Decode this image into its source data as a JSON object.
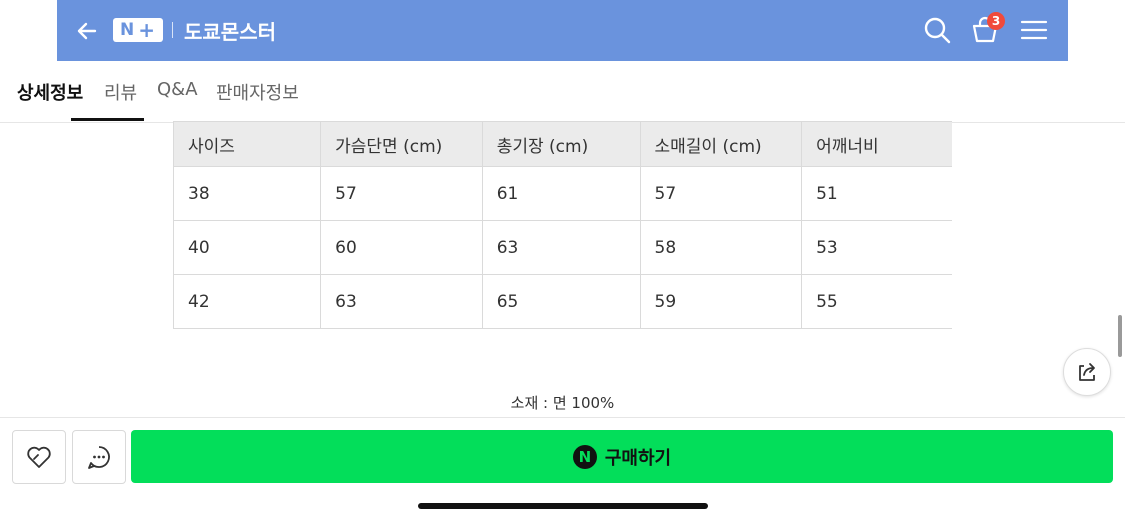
{
  "header": {
    "logo_text": "N",
    "logo_plus": "+",
    "store_title": "도쿄몬스터",
    "cart_count": "3",
    "icons": [
      "back-arrow-icon",
      "search-icon",
      "cart-icon",
      "menu-icon"
    ],
    "background_color": "#6a93dd"
  },
  "tabs": [
    {
      "label": "상세정보",
      "active": true
    },
    {
      "label": "리뷰",
      "active": false
    },
    {
      "label": "Q&A",
      "active": false
    },
    {
      "label": "판매자정보",
      "active": false
    }
  ],
  "size_table": {
    "headers": [
      "사이즈",
      "가슴단면 (cm)",
      "총기장 (cm)",
      "소매길이 (cm)",
      "어깨너비"
    ],
    "rows": [
      [
        "38",
        "57",
        "61",
        "57",
        "51"
      ],
      [
        "40",
        "60",
        "63",
        "58",
        "53"
      ],
      [
        "42",
        "63",
        "65",
        "59",
        "55"
      ]
    ]
  },
  "material_text": "소재 : 면 100%",
  "bottom_bar": {
    "buy_icon_text": "N",
    "buy_label": "구매하기",
    "buy_color": "#03de5a",
    "icons": [
      "heart-icon",
      "chat-icon"
    ]
  },
  "share_icon": "share-icon"
}
